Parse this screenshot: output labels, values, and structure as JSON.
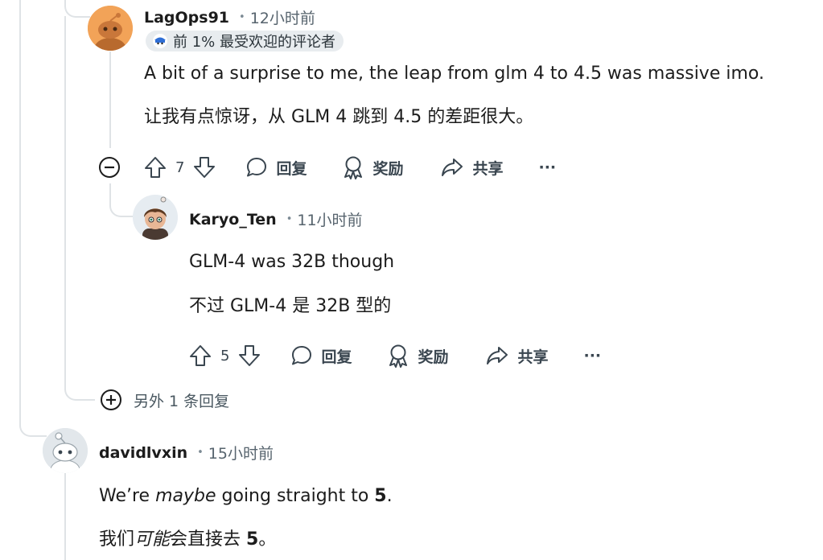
{
  "comments": [
    {
      "author": "LagOps91",
      "time": "12小时前",
      "badge": "前 1% 最受欢迎的评论者",
      "body_en": "A bit of a surprise to me, the leap from glm 4 to 4.5 was massive imo.",
      "body_zh": "让我有点惊讶，从 GLM 4 跳到 4.5 的差距很大。",
      "votes": "7",
      "reply_label": "回复",
      "award_label": "奖励",
      "share_label": "共享",
      "more_label": "···"
    },
    {
      "author": "Karyo_Ten",
      "time": "11小时前",
      "body_en": "GLM-4 was 32B though",
      "body_zh": "不过 GLM-4 是 32B 型的",
      "votes": "5",
      "reply_label": "回复",
      "award_label": "奖励",
      "share_label": "共享",
      "more_label": "···"
    },
    {
      "author": "davidlvxin",
      "time": "15小时前",
      "body_en_1": "We’re ",
      "body_en_em": "maybe",
      "body_en_2": " going straight to ",
      "body_en_strong": "5",
      "body_en_3": ".",
      "body_zh_1": "我们",
      "body_zh_em": "可能",
      "body_zh_2": "会直接去 ",
      "body_zh_strong": "5",
      "body_zh_3": "。"
    }
  ],
  "more_replies_label": "另外 1 条回复",
  "dot": "•",
  "icons": {
    "collapse": "minus-circle-icon",
    "expand": "plus-circle-icon",
    "upvote": "arrow-up-icon",
    "downvote": "arrow-down-icon",
    "reply": "speech-bubble-icon",
    "award": "award-ribbon-icon",
    "share": "share-arrow-icon"
  }
}
